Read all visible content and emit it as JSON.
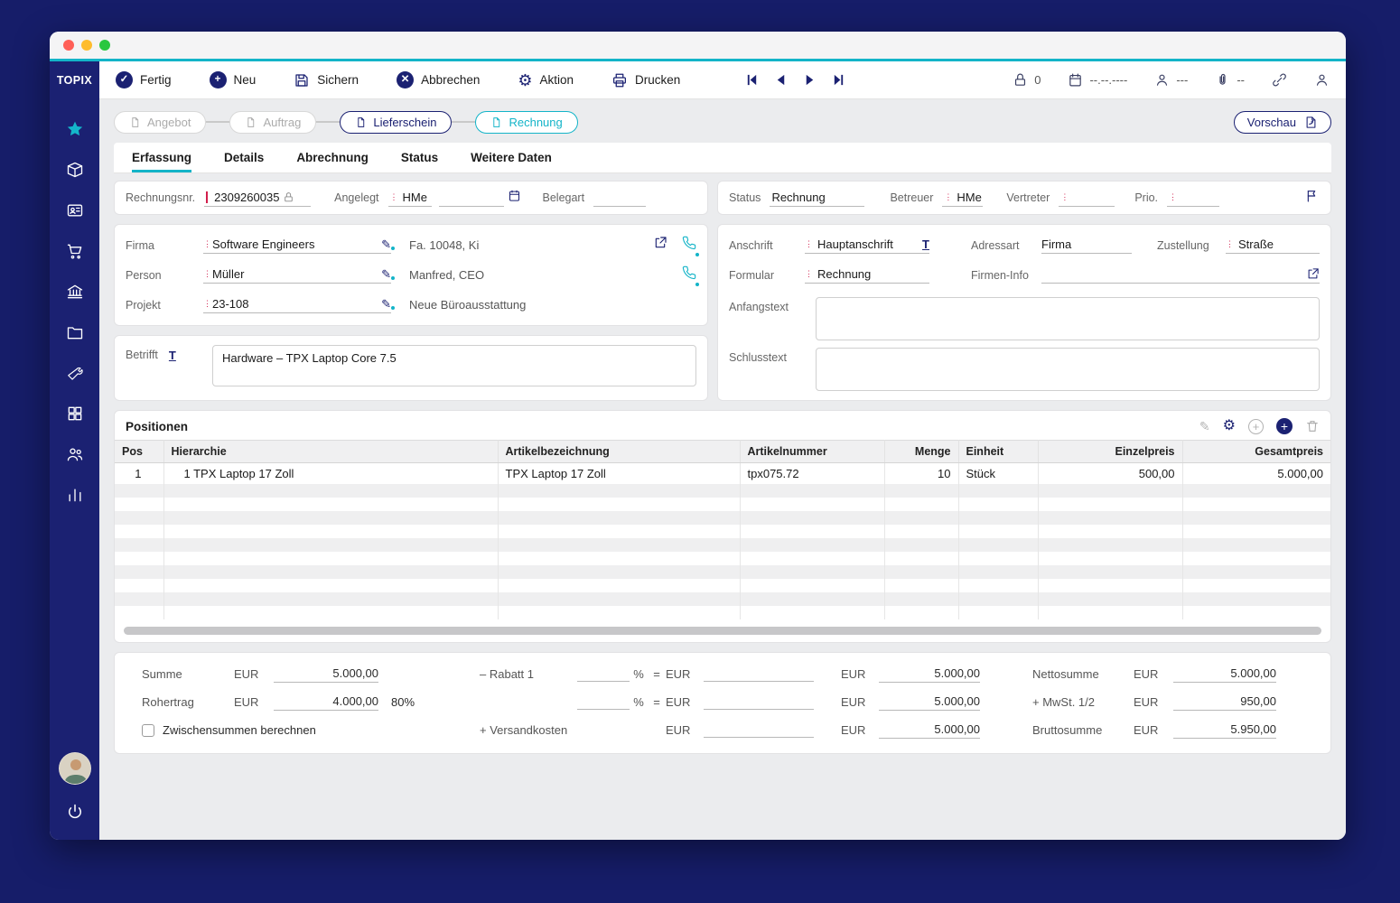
{
  "sidebar": {
    "brand": "TOPIX"
  },
  "toolbar": {
    "fertig": "Fertig",
    "neu": "Neu",
    "sichern": "Sichern",
    "abbrechen": "Abbrechen",
    "aktion": "Aktion",
    "drucken": "Drucken",
    "lock_count": "0",
    "date_placeholder": "--.--.----",
    "user_placeholder": "---",
    "attach_placeholder": "--"
  },
  "workflow": {
    "angebot": "Angebot",
    "auftrag": "Auftrag",
    "lieferschein": "Lieferschein",
    "rechnung": "Rechnung",
    "vorschau": "Vorschau"
  },
  "tabs": {
    "erfassung": "Erfassung",
    "details": "Details",
    "abrechnung": "Abrechnung",
    "status": "Status",
    "weitere": "Weitere Daten"
  },
  "head": {
    "rechnungsnr_label": "Rechnungsnr.",
    "rechnungsnr": "2309260035",
    "angelegt_label": "Angelegt",
    "angelegt": "HMe",
    "belegart_label": "Belegart",
    "status_label": "Status",
    "status": "Rechnung",
    "betreuer_label": "Betreuer",
    "betreuer": "HMe",
    "vertreter_label": "Vertreter",
    "prio_label": "Prio."
  },
  "company": {
    "firma_label": "Firma",
    "firma": "Software Engineers",
    "firma_info": "Fa. 10048, Ki",
    "person_label": "Person",
    "person": "Müller",
    "person_info": "Manfred, CEO",
    "projekt_label": "Projekt",
    "projekt": "23-108",
    "projekt_info": "Neue Büroausstattung"
  },
  "betrifft": {
    "label": "Betrifft",
    "value": "Hardware – TPX Laptop Core 7.5"
  },
  "address": {
    "anschrift_label": "Anschrift",
    "anschrift": "Hauptanschrift",
    "adressart_label": "Adressart",
    "adressart": "Firma",
    "zustellung_label": "Zustellung",
    "zustellung": "Straße",
    "formular_label": "Formular",
    "formular": "Rechnung",
    "firmeninfo_label": "Firmen-Info",
    "anfangstext_label": "Anfangstext",
    "schlusstext_label": "Schlusstext"
  },
  "positions": {
    "title": "Positionen",
    "headers": [
      "Pos",
      "Hierarchie",
      "Artikelbezeichnung",
      "Artikelnummer",
      "Menge",
      "Einheit",
      "Einzelpreis",
      "Gesamtpreis"
    ],
    "row": {
      "pos": "1",
      "hierarchie": "1 TPX Laptop 17 Zoll",
      "bezeichnung": "TPX Laptop 17 Zoll",
      "nummer": "tpx075.72",
      "menge": "10",
      "einheit": "Stück",
      "einzelpreis": "500,00",
      "gesamtpreis": "5.000,00"
    },
    "empty_rows": 10
  },
  "summary": {
    "summe_label": "Summe",
    "cur": "EUR",
    "summe": "5.000,00",
    "rohertrag_label": "Rohertrag",
    "rohertrag": "4.000,00",
    "rohertrag_pct": "80%",
    "zwischensummen_label": "Zwischensummen berechnen",
    "rabatt_label": "– Rabatt 1",
    "pct": "%",
    "eq": "=",
    "versand_label": "+ Versandkosten",
    "zeile1_summe": "5.000,00",
    "zeile2_summe": "5.000,00",
    "zeile3_summe": "5.000,00",
    "netto_label": "Nettosumme",
    "netto": "5.000,00",
    "mwst_label": "+ MwSt. 1/2",
    "mwst": "950,00",
    "brutto_label": "Bruttosumme",
    "brutto": "5.950,00"
  },
  "icons": {
    "check": "✓",
    "plus": "+",
    "x": "✕",
    "gear": "⚙",
    "pencil": "✎",
    "marker": "⋮",
    "text_format": "T"
  }
}
